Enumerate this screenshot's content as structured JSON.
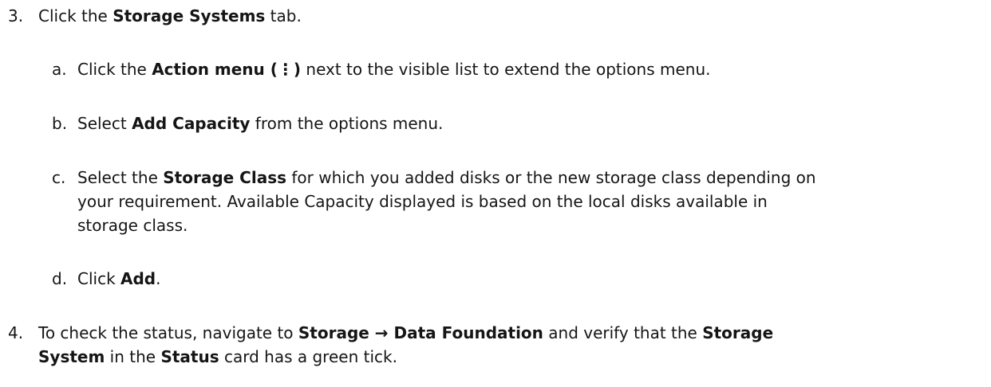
{
  "step3": {
    "number": "3.",
    "pre": "Click the ",
    "tab_name": "Storage Systems",
    "post": " tab.",
    "sub_a": {
      "letter": "a.",
      "pre": "Click the ",
      "menu_name": "Action menu (",
      "kebab_glyph": "⋮",
      "menu_close": ")",
      "post": " next to the visible list to extend the options menu."
    },
    "sub_b": {
      "letter": "b.",
      "pre": "Select ",
      "item": "Add Capacity",
      "post": " from the options menu."
    },
    "sub_c": {
      "letter": "c.",
      "pre": "Select the ",
      "item": "Storage Class",
      "line1_post": " for which you added disks or the new storage class depending on",
      "line2": "your requirement. Available Capacity displayed is based on the local disks available in",
      "line3": "storage class."
    },
    "sub_d": {
      "letter": "d.",
      "pre": "Click ",
      "item": "Add",
      "post": "."
    }
  },
  "step4": {
    "number": "4.",
    "pre": "To check the status, navigate to ",
    "nav_path": "Storage → Data Foundation",
    "mid": " and verify that the ",
    "item_line1": "Storage",
    "item_line2": "System",
    "line2_mid": " in the ",
    "card": "Status",
    "line2_post": " card has a green tick."
  }
}
